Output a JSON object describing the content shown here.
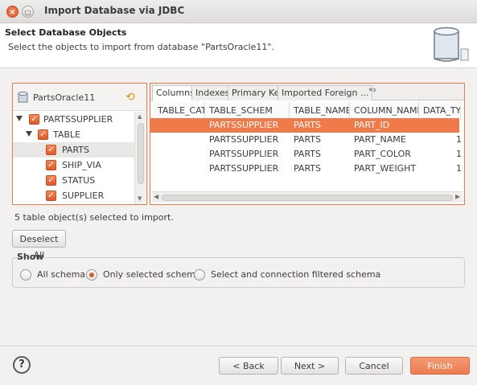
{
  "window": {
    "title": "Import Database via JDBC",
    "close_glyph": "×",
    "maximize_glyph": "□"
  },
  "header": {
    "title": "Select Database Objects",
    "description": "Select the objects to import from database \"PartsOracle11\"."
  },
  "tree": {
    "connection": "PartsOracle11",
    "refresh_glyph": "⟲",
    "nodes": [
      {
        "label": "PARTSSUPPLIER",
        "checked": true
      },
      {
        "label": "TABLE",
        "checked": true
      },
      {
        "label": "PARTS",
        "checked": true,
        "selected": true
      },
      {
        "label": "SHIP_VIA",
        "checked": true
      },
      {
        "label": "STATUS",
        "checked": true
      },
      {
        "label": "SUPPLIER",
        "checked": true
      }
    ],
    "check_glyph": "✓",
    "scroll_up": "▲",
    "scroll_down": "▼"
  },
  "details": {
    "tabs": [
      "Columns",
      "Indexes",
      "Primary Key",
      "Imported Foreign ..."
    ],
    "tabs_more": "»₃",
    "columns": [
      "TABLE_CAT",
      "TABLE_SCHEM",
      "TABLE_NAME",
      "COLUMN_NAME",
      "DATA_TYP"
    ],
    "rows": [
      {
        "cat": "",
        "schem": "PARTSSUPPLIER",
        "name": "PARTS",
        "column": "PART_ID",
        "type": ""
      },
      {
        "cat": "",
        "schem": "PARTSSUPPLIER",
        "name": "PARTS",
        "column": "PART_NAME",
        "type": "1"
      },
      {
        "cat": "",
        "schem": "PARTSSUPPLIER",
        "name": "PARTS",
        "column": "PART_COLOR",
        "type": "1"
      },
      {
        "cat": "",
        "schem": "PARTSSUPPLIER",
        "name": "PARTS",
        "column": "PART_WEIGHT",
        "type": "1"
      }
    ],
    "scroll_left": "◀",
    "scroll_right": "▶"
  },
  "status_text": "5 table object(s) selected to import.",
  "deselect_all": "Deselect All",
  "show": {
    "label": "Show",
    "options": [
      {
        "label": "All schema",
        "selected": false
      },
      {
        "label": "Only selected schema",
        "selected": true
      },
      {
        "label": "Select and connection filtered schema",
        "selected": false
      }
    ]
  },
  "footer": {
    "help": "?",
    "back": "< Back",
    "next": "Next >",
    "cancel": "Cancel",
    "finish": "Finish"
  },
  "colors": {
    "accent": "#f07a4a",
    "selection_text": "#ffffff"
  }
}
